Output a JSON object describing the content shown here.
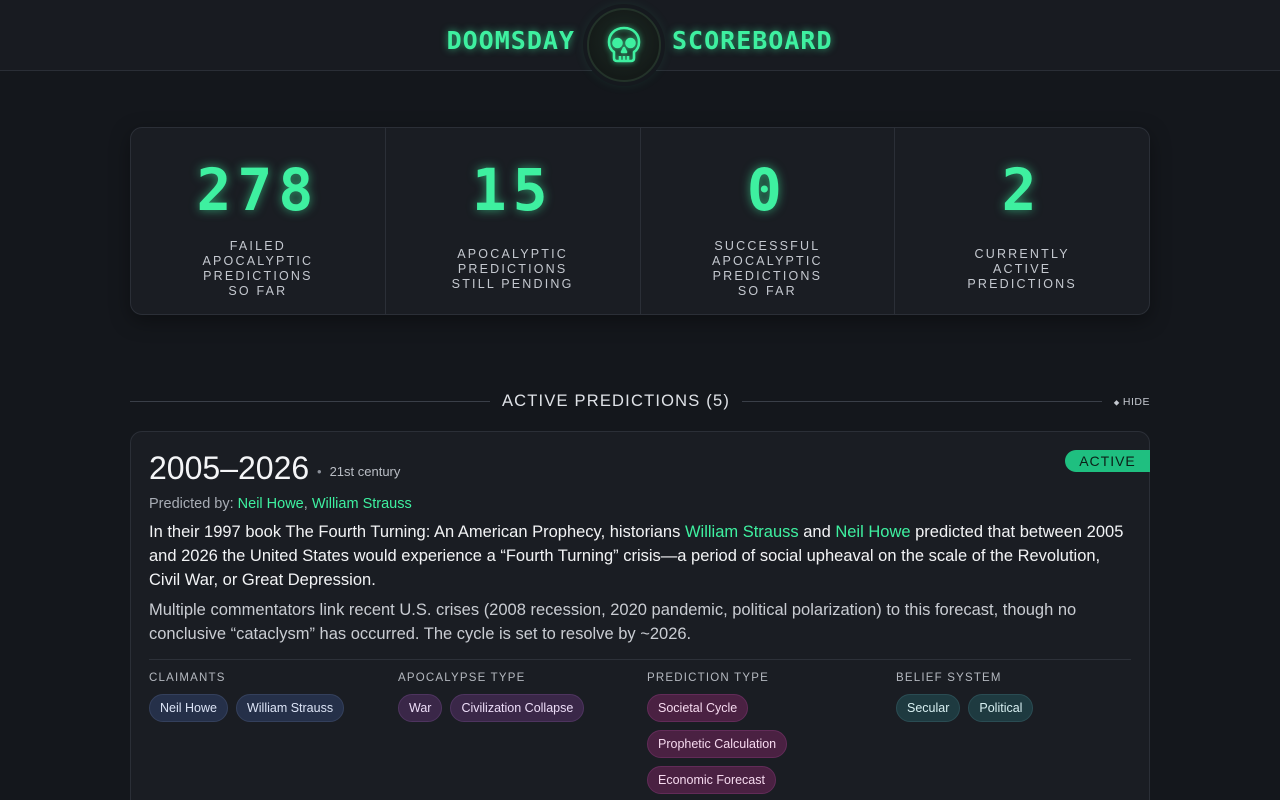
{
  "header": {
    "left_title": "DOOMSDAY",
    "right_title": "SCOREBOARD",
    "logo_icon": "skull-icon",
    "accent": "#3ef0a0"
  },
  "stats": [
    {
      "value": "278",
      "label": "FAILED APOCALYPTIC PREDICTIONS SO FAR"
    },
    {
      "value": "15",
      "label": "APOCALYPTIC PREDICTIONS STILL PENDING"
    },
    {
      "value": "0",
      "label": "SUCCESSFUL APOCALYPTIC PREDICTIONS SO FAR"
    },
    {
      "value": "2",
      "label": "CURRENTLY ACTIVE PREDICTIONS"
    }
  ],
  "section": {
    "title": "ACTIVE PREDICTIONS (5)",
    "hide_label": "HIDE"
  },
  "card": {
    "status": "ACTIVE",
    "status_color": "#1fbf80",
    "title": "2005–2026",
    "era": "21st century",
    "predicted_by_label": "Predicted by:",
    "predictors": [
      "Neil Howe",
      "William Strauss"
    ],
    "desc_prefix": "In their 1997 book The Fourth Turning: An American Prophecy, historians ",
    "desc_link1": "William Strauss",
    "desc_and": " and ",
    "desc_link2": "Neil Howe",
    "desc_suffix": " predicted that between 2005 and 2026 the United States would experience a “Fourth Turning” crisis—a period of social upheaval on the scale of the Revolution, Civil War, or Great Depression.",
    "desc2": "Multiple commentators link recent U.S. crises (2008 recession, 2020 pandemic, political polarization) to this forecast, though no conclusive “cataclysm” has occurred. The cycle is set to resolve by ~2026.",
    "meta": {
      "claimants": {
        "heading": "CLAIMANTS",
        "tags": [
          "Neil Howe",
          "William Strauss"
        ]
      },
      "apocalypse_type": {
        "heading": "APOCALYPSE TYPE",
        "tags": [
          "War",
          "Civilization Collapse"
        ]
      },
      "prediction_type": {
        "heading": "PREDICTION TYPE",
        "tags": [
          "Societal Cycle",
          "Prophetic Calculation",
          "Economic Forecast"
        ]
      },
      "belief_system": {
        "heading": "BELIEF SYSTEM",
        "tags": [
          "Secular",
          "Political"
        ]
      }
    }
  }
}
